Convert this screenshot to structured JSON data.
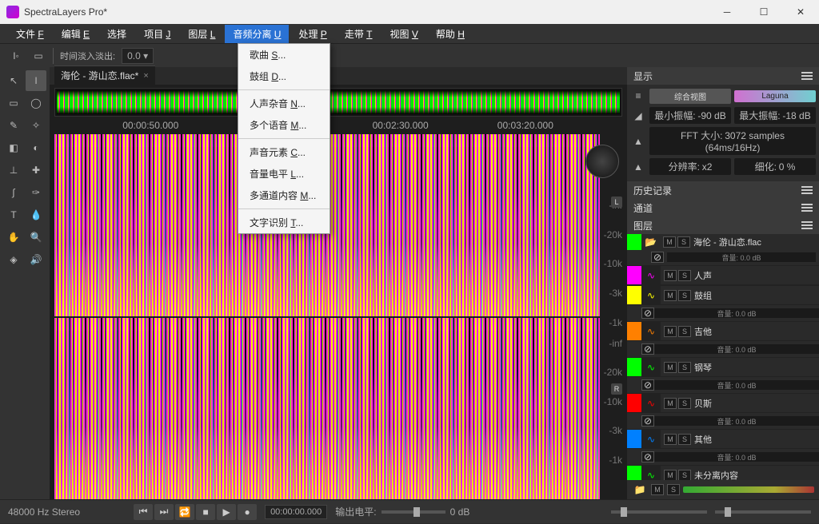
{
  "app": {
    "title": "SpectraLayers Pro*"
  },
  "menubar": [
    {
      "label": "文件",
      "accel": "F"
    },
    {
      "label": "编辑",
      "accel": "E"
    },
    {
      "label": "选择",
      "accel": ""
    },
    {
      "label": "项目",
      "accel": "J"
    },
    {
      "label": "图层",
      "accel": "L"
    },
    {
      "label": "音频分离",
      "accel": "U",
      "active": true
    },
    {
      "label": "处理",
      "accel": "P"
    },
    {
      "label": "走带",
      "accel": "T"
    },
    {
      "label": "视图",
      "accel": "V"
    },
    {
      "label": "帮助",
      "accel": "H"
    }
  ],
  "dropdown": [
    {
      "label": "歌曲",
      "accel": "S",
      "suffix": "..."
    },
    {
      "label": "鼓组",
      "accel": "D",
      "suffix": "..."
    },
    {
      "sep": true
    },
    {
      "label": "人声杂音",
      "accel": "N",
      "suffix": "..."
    },
    {
      "label": "多个语音",
      "accel": "M",
      "suffix": "..."
    },
    {
      "sep": true
    },
    {
      "label": "声音元素",
      "accel": "C",
      "suffix": "..."
    },
    {
      "label": "音量电平",
      "accel": "L",
      "suffix": "..."
    },
    {
      "label": "多通道内容",
      "accel": "M",
      "suffix": "..."
    },
    {
      "sep": true
    },
    {
      "label": "文字识别",
      "accel": "T",
      "suffix": "..."
    }
  ],
  "toolbar": {
    "fade_label": "时间淡入淡出:",
    "fade_value": "0.0 ▾"
  },
  "tabs": [
    {
      "name": "海伦 - 游山恋.flac*"
    }
  ],
  "ruler": [
    "00:00:50.000",
    "00:02:30.000",
    "00:03:20.000"
  ],
  "freq_marks": [
    "-inf",
    "-20k",
    "-10k",
    "-3k",
    "-1k"
  ],
  "channels": [
    "L",
    "R"
  ],
  "display_panel": {
    "title": "显示",
    "view_btn": "综合视图",
    "colormap": "Laguna",
    "min_label": "最小振幅:",
    "min_val": "-90 dB",
    "max_label": "最大振幅:",
    "max_val": "-18 dB",
    "fft_label": "FFT 大小:",
    "fft_val": "3072 samples (64ms/16Hz)",
    "res_label": "分辨率:",
    "res_val": "x2",
    "refine_label": "细化:",
    "refine_val": "0 %"
  },
  "history_panel": {
    "title": "历史记录"
  },
  "channel_panel": {
    "title": "通道"
  },
  "layers_panel": {
    "title": "图层",
    "master": {
      "name": "海伦 - 游山恋.flac",
      "vol": "音量: 0.0 dB"
    },
    "layers": [
      {
        "name": "人声",
        "color": "#ff00ff"
      },
      {
        "name": "鼓组",
        "color": "#ffff00",
        "vol": "音量: 0.0 dB"
      },
      {
        "name": "吉他",
        "color": "#ff8000",
        "vol": "音量: 0.0 dB"
      },
      {
        "name": "钢琴",
        "color": "#00ff00",
        "vol": "音量: 0.0 dB"
      },
      {
        "name": "贝斯",
        "color": "#ff0000",
        "vol": "音量: 0.0 dB"
      },
      {
        "name": "其他",
        "color": "#0080ff",
        "vol": "音量: 0.0 dB"
      },
      {
        "name": "未分离内容",
        "color": "#00ff00"
      }
    ]
  },
  "statusbar": {
    "format": "48000 Hz Stereo",
    "time": "00:00:00.000",
    "out_label": "输出电平:",
    "out_val": "0 dB"
  }
}
